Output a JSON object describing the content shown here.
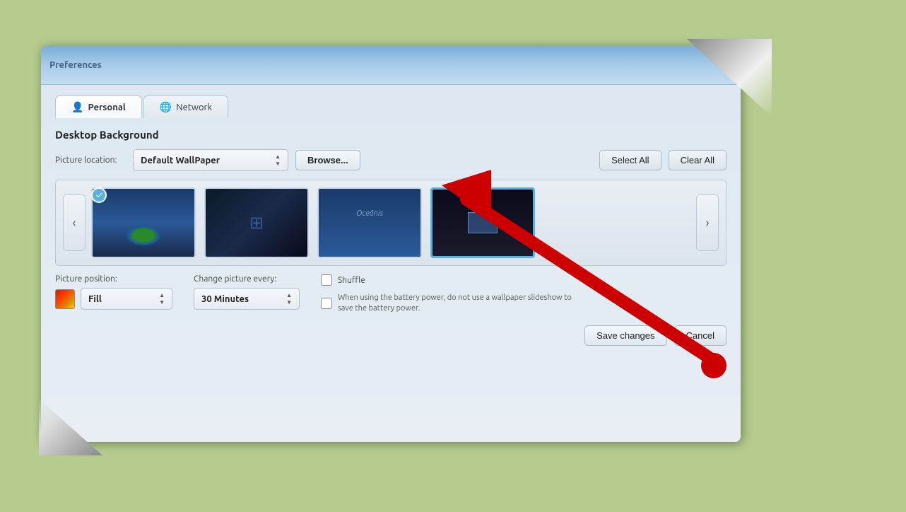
{
  "page": {
    "background_color": "#b5cc8e"
  },
  "titlebar": {
    "title": "Preferences"
  },
  "tabs": [
    {
      "id": "personal",
      "label": "Personal",
      "icon": "👤",
      "active": true
    },
    {
      "id": "network",
      "label": "Network",
      "icon": "🌐",
      "active": false
    }
  ],
  "section": {
    "title": "Desktop Background"
  },
  "picture_location": {
    "label": "Picture location:",
    "value": "Default WallPaper",
    "browse_label": "Browse..."
  },
  "actions": {
    "select_all_label": "Select All",
    "clear_all_label": "Clear All"
  },
  "wallpapers": [
    {
      "id": "wp1",
      "name": "Earth Wallpaper",
      "checked": true,
      "selected": false
    },
    {
      "id": "wp2",
      "name": "Windows Wallpaper",
      "checked": false,
      "selected": false
    },
    {
      "id": "wp3",
      "name": "Oceanic Wallpaper",
      "checked": false,
      "selected": false
    },
    {
      "id": "wp4",
      "name": "Dark Wallpaper",
      "checked": false,
      "selected": true
    }
  ],
  "nav": {
    "prev_label": "‹",
    "next_label": "›"
  },
  "picture_position": {
    "label": "Picture position:",
    "value": "Fill",
    "color_swatch": "orange-red"
  },
  "change_picture": {
    "label": "Change picture every:",
    "value": "30 Minutes"
  },
  "shuffle": {
    "label": "Shuffle",
    "checked": false
  },
  "battery_note": "When using the battery power, do not use a wallpaper slideshow to save the battery power.",
  "buttons": {
    "save_label": "Save changes",
    "cancel_label": "Cancel"
  }
}
